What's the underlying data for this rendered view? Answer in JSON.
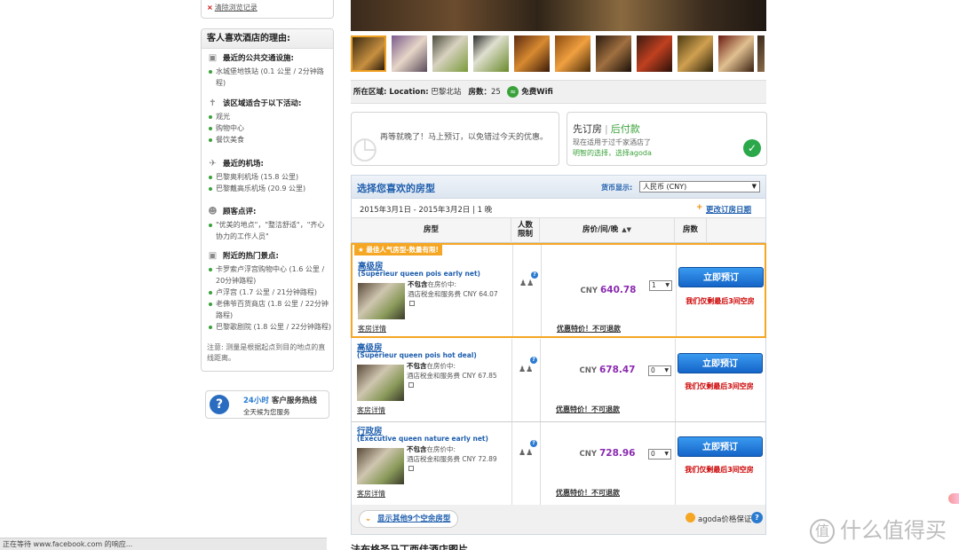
{
  "sidebar": {
    "clear_history": "清除浏览记录",
    "reasons_title": "客人喜欢酒店的理由:",
    "sections": [
      {
        "icon": "car-icon",
        "title": "最近的公共交通设施:",
        "items": [
          "水城堡地铁站 (0.1 公里 / 2分钟路程)"
        ]
      },
      {
        "icon": "signpost-icon",
        "title": "该区域适合于以下活动:",
        "items": [
          "观光",
          "购物中心",
          "餐饮美食"
        ]
      },
      {
        "icon": "airplane-icon",
        "title": "最近的机场:",
        "items": [
          "巴黎奥利机场 (15.8 公里)",
          "巴黎戴高乐机场 (20.9 公里)"
        ]
      },
      {
        "icon": "reviewer-icon",
        "title": "顾客点评:",
        "items": [
          "\"优美的地点\"，\"整洁舒适\"，\"齐心协力的工作人员\""
        ]
      },
      {
        "icon": "camera-icon",
        "title": "附近的热门景点:",
        "items": [
          "卡罗索卢浮宫购物中心 (1.6 公里 / 20分钟路程)",
          "卢浮宫 (1.7 公里 / 21分钟路程)",
          "老佛爷百货商店 (1.8 公里 / 22分钟路程)",
          "巴黎歌剧院 (1.8 公里 / 22分钟路程)"
        ]
      }
    ],
    "note": "注意: 测量是根据起点到目的地点的直线距离。",
    "hotline": {
      "hours": "24小时",
      "label": "客户服务热线",
      "sub": "全天候为您服务"
    }
  },
  "status_bar": "正在等待 www.facebook.com 的响应...",
  "info_bar": {
    "area_label": "所在区域: Location:",
    "area_value": "巴黎北站",
    "rooms_label": "房数：",
    "rooms_value": "25",
    "wifi": "免费Wifi"
  },
  "late_notice": "再等就晚了！马上预订，以免错过今天的优惠。",
  "promo": {
    "book_first": "先订房",
    "pay_later": "后付款",
    "applies": "现在适用于过千家酒店了",
    "smart_choice": "明智的选择，选择agoda"
  },
  "rooms_panel": {
    "title": "选择您喜欢的房型",
    "currency_label": "货币显示:",
    "currency_value": "人民币 (CNY)",
    "dates": "2015年3月1日 - 2015年3月2日 | 1 晚",
    "change_dates": "更改订房日期",
    "columns": {
      "room": "房型",
      "capacity_1": "人数",
      "capacity_2": "限制",
      "price": "房价/间/晚",
      "qty": "房数"
    },
    "rows": [
      {
        "badge": "最佳人气房型-数量有限!",
        "name": "高级房",
        "sub": "(Supérieur queen pois early net)",
        "excluded_label": "不包含",
        "excluded_rest": "在房价中:",
        "tax_line": "酒店税金和服务费 CNY 64.07",
        "details": "客房详情",
        "currency": "CNY",
        "price": "640.78",
        "terms": "优惠特价！不可退款",
        "qty": "1",
        "book": "立即预订",
        "left": "我们仅剩最后3间空房"
      },
      {
        "badge": "",
        "name": "高级房",
        "sub": "(Supérieur queen pois hot deal)",
        "excluded_label": "不包含",
        "excluded_rest": "在房价中:",
        "tax_line": "酒店税金和服务费 CNY 67.85",
        "details": "客房详情",
        "currency": "CNY",
        "price": "678.47",
        "terms": "优惠特价！不可退款",
        "qty": "0",
        "book": "立即预订",
        "left": "我们仅剩最后3间空房"
      },
      {
        "badge": "",
        "name": "行政房",
        "sub": "(Exécutive queen nature early net)",
        "excluded_label": "不包含",
        "excluded_rest": "在房价中:",
        "tax_line": "酒店税金和服务费 CNY 72.89",
        "details": "客房详情",
        "currency": "CNY",
        "price": "728.96",
        "terms": "优惠特价！不可退款",
        "qty": "0",
        "book": "立即预订",
        "left": "我们仅剩最后3间空房"
      }
    ],
    "show_more": "显示其他9个空余房型",
    "guarantee": "agoda价格保证"
  },
  "photos_title": "法布格圣马丁西佳酒店图片",
  "watermark": "什么值得买",
  "colors": {
    "link_blue": "#1f5fae",
    "price_purple": "#8a2ab0",
    "urgent_red": "#cc0000",
    "highlight_orange": "#f5a623",
    "success_green": "#3aa23a"
  }
}
